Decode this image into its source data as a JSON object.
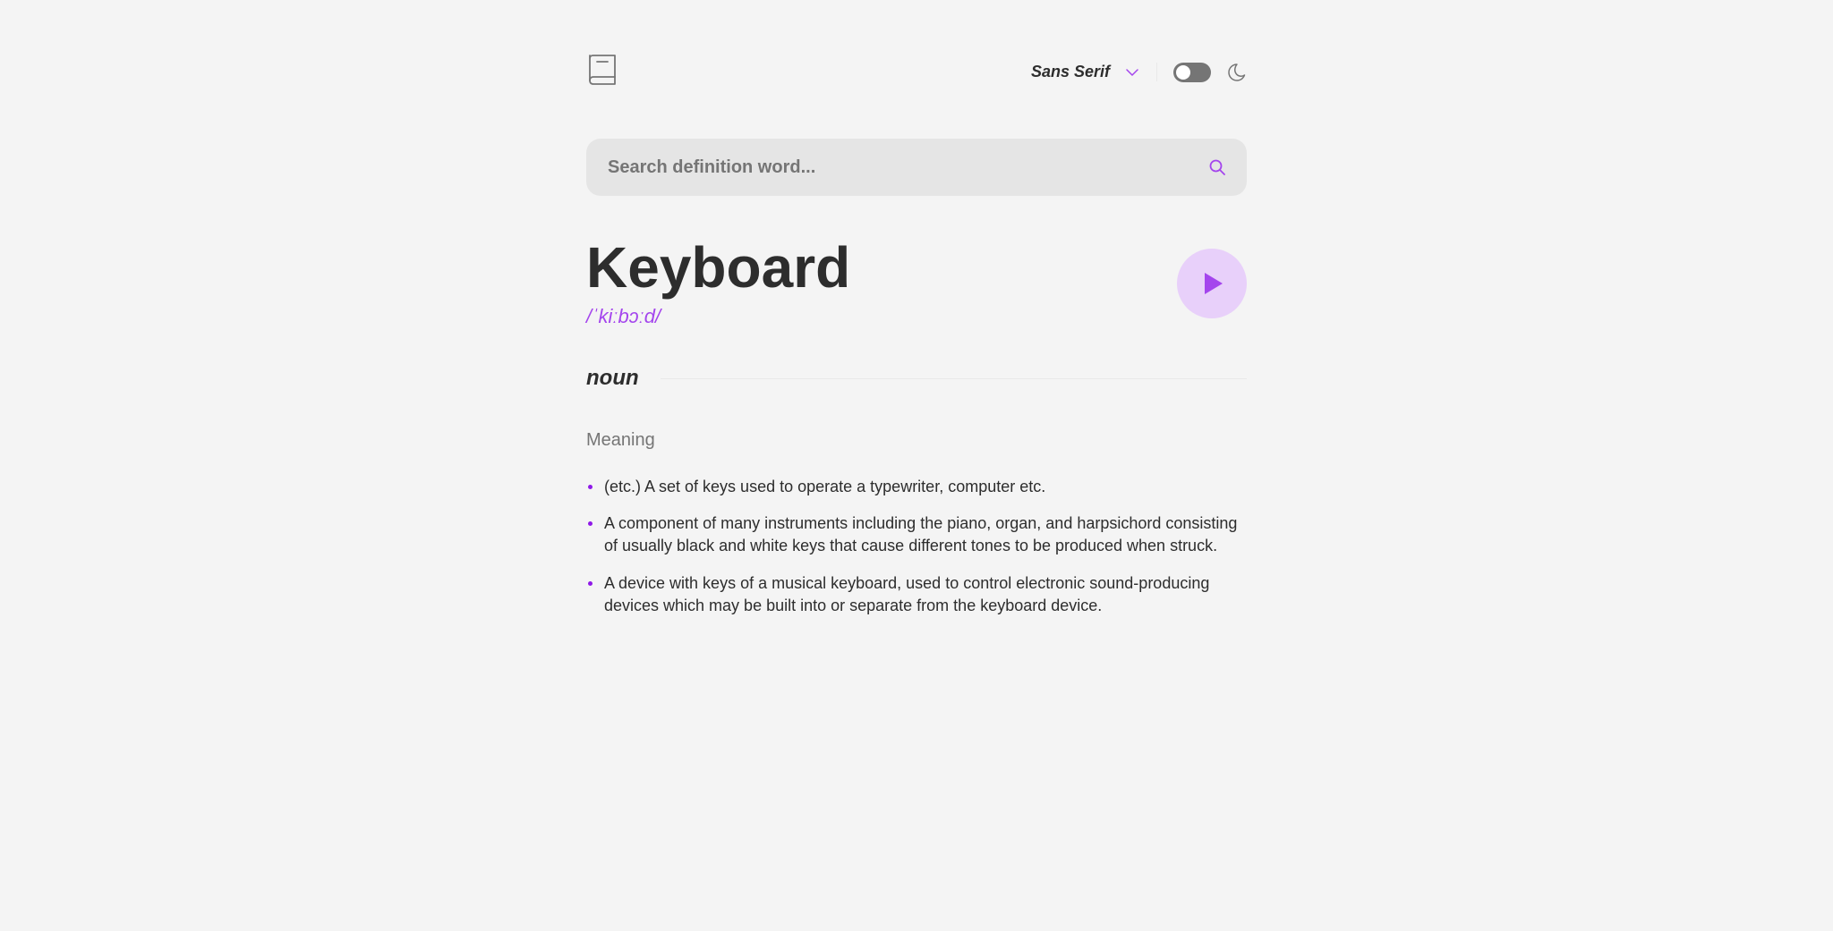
{
  "header": {
    "font_selector_label": "Sans Serif"
  },
  "search": {
    "placeholder": "Search definition word..."
  },
  "word": {
    "title": "Keyboard",
    "phonetic": "/ˈkiːbɔːd/"
  },
  "section": {
    "pos": "noun",
    "meaning_label": "Meaning",
    "definitions": [
      "(etc.) A set of keys used to operate a typewriter, computer etc.",
      "A component of many instruments including the piano, organ, and harpsichord consisting of usually black and white keys that cause different tones to be produced when struck.",
      "A device with keys of a musical keyboard, used to control electronic sound-producing devices which may be built into or separate from the keyboard device."
    ]
  }
}
